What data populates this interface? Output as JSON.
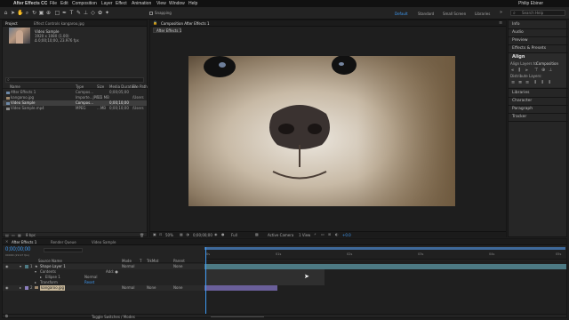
{
  "menubar": {
    "apple": "",
    "items": [
      "After Effects CC",
      "File",
      "Edit",
      "Composition",
      "Layer",
      "Effect",
      "Animation",
      "View",
      "Window",
      "Help"
    ],
    "center_title": "Adobe After Effects CC 2017 - Untitled Project *",
    "user": "Philip Ebiner"
  },
  "toolbar": {
    "snapping_label": "Snapping",
    "workspaces": [
      "Default",
      "Standard",
      "Small Screen",
      "Libraries"
    ],
    "search_placeholder": "Search Help"
  },
  "project_panel": {
    "tabs": [
      "Project",
      "Effect Controls kangaroo.jpg"
    ],
    "preview": {
      "name": "Video Sample",
      "dims": "1920 x 1080 (1.00)",
      "duration": "Δ 0;00;10;00, 23.976 fps"
    },
    "search_placeholder": "",
    "columns": [
      "Name",
      "Type",
      "Size",
      "Media Duration",
      "File Path"
    ],
    "items": [
      {
        "name": "After Effects 1",
        "type": "Compos...",
        "size": "",
        "duration": "0;00;05;00",
        "path": ""
      },
      {
        "name": "kangaroo.jpg",
        "type": "Importe...JPEG",
        "size": "5.5 MB",
        "duration": "",
        "path": "/Users"
      },
      {
        "name": "Video Sample",
        "type": "Compos...",
        "size": "",
        "duration": "0;00;10;00",
        "path": "",
        "selected": true
      },
      {
        "name": "Video Sample.mp4",
        "type": "MPEG",
        "size": "...MB",
        "duration": "0;00;10;00",
        "path": "/Users"
      }
    ],
    "bpc": "8 bpc"
  },
  "composition_panel": {
    "tab": "Composition After Effects 1",
    "subtab": "After Effects 1",
    "zoom": "50%",
    "timecode": "0;00;00;00",
    "resolution": "Full",
    "camera": "Active Camera",
    "views": "1 View",
    "exposure": "+0.0"
  },
  "right_panel": {
    "top_items": [
      "Info",
      "Audio",
      "Preview",
      "Effects & Presets"
    ],
    "align": {
      "title": "Align",
      "align_to_label": "Align Layers to:",
      "align_to_value": "Composition",
      "distribute_label": "Distribute Layers:"
    },
    "bottom_items": [
      "Libraries",
      "Character",
      "Paragraph",
      "Tracker"
    ]
  },
  "timeline": {
    "tabs": [
      "After Effects 1",
      "Render Queue",
      "Video Sample"
    ],
    "timecode": "0;00;00;00",
    "timecode_sub": "00000 (29.97 fps)",
    "columns": [
      "Source Name",
      "Mode",
      "T",
      "TrkMat",
      "Parent"
    ],
    "layers": [
      {
        "num": "1",
        "name": "Shape Layer 1",
        "mode": "Normal",
        "trkmat": "",
        "parent": "None"
      },
      {
        "num": "",
        "name": "Contents",
        "mode": "",
        "trkmat": "",
        "parent": "",
        "extra": "Add: ●"
      },
      {
        "num": "",
        "name": "Ellipse 1",
        "mode": "Normal",
        "trkmat": "",
        "parent": ""
      },
      {
        "num": "",
        "name": "Transform",
        "mode": "Reset",
        "trkmat": "",
        "parent": ""
      },
      {
        "num": "2",
        "name": "kangaroo.jpg",
        "mode": "Normal",
        "trkmat": "None",
        "parent": "None"
      }
    ],
    "ruler": [
      "0s",
      "01s",
      "02s",
      "03s",
      "04s",
      "05s"
    ],
    "toggle_label": "Toggle Switches / Modes"
  },
  "colors": {
    "accent_blue": "#2d8ceb",
    "timecode_blue": "#3f9bf5",
    "layer_track": "#6a5f9a",
    "shape_track": "#4d7a84",
    "workarea": "#3f6a9c"
  }
}
